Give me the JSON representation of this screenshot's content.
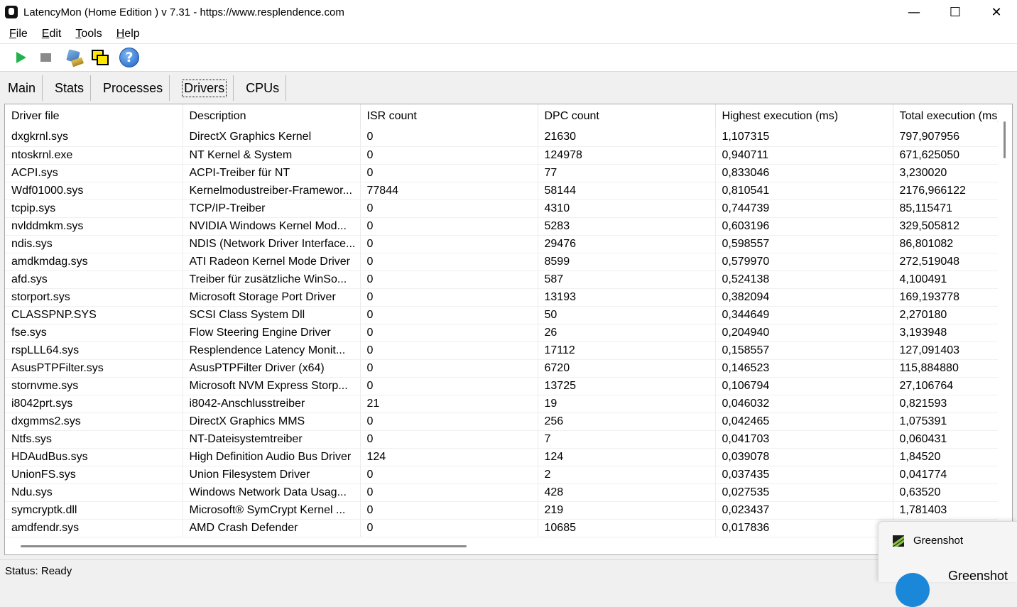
{
  "window": {
    "title": "LatencyMon  (Home Edition )  v 7.31 - https://www.resplendence.com",
    "minimize": "—",
    "maximize": "☐",
    "close": "✕"
  },
  "menu": [
    "File",
    "Edit",
    "Tools",
    "Help"
  ],
  "toolbar": {
    "icons": [
      "play-icon",
      "stop-icon",
      "broom-icon",
      "windows-icon",
      "help-icon"
    ],
    "help_glyph": "?"
  },
  "tabs": [
    "Main",
    "Stats",
    "Processes",
    "Drivers",
    "CPUs"
  ],
  "active_tab": "Drivers",
  "drivers": {
    "columns": [
      "Driver file",
      "Description",
      "ISR count",
      "DPC count",
      "Highest execution (ms)",
      "Total execution (ms)"
    ],
    "rows": [
      [
        "dxgkrnl.sys",
        "DirectX Graphics Kernel",
        "0",
        "21630",
        "1,107315",
        "797,907956"
      ],
      [
        "ntoskrnl.exe",
        "NT Kernel & System",
        "0",
        "124978",
        "0,940711",
        "671,625050"
      ],
      [
        "ACPI.sys",
        "ACPI-Treiber für NT",
        "0",
        "77",
        "0,833046",
        "3,230020"
      ],
      [
        "Wdf01000.sys",
        "Kernelmodustreiber-Framewor...",
        "77844",
        "58144",
        "0,810541",
        "2176,966122"
      ],
      [
        "tcpip.sys",
        "TCP/IP-Treiber",
        "0",
        "4310",
        "0,744739",
        "85,115471"
      ],
      [
        "nvlddmkm.sys",
        "NVIDIA Windows Kernel Mod...",
        "0",
        "5283",
        "0,603196",
        "329,505812"
      ],
      [
        "ndis.sys",
        "NDIS (Network Driver Interface...",
        "0",
        "29476",
        "0,598557",
        "86,801082"
      ],
      [
        "amdkmdag.sys",
        "ATI Radeon Kernel Mode Driver",
        "0",
        "8599",
        "0,579970",
        "272,519048"
      ],
      [
        "afd.sys",
        "Treiber für zusätzliche WinSo...",
        "0",
        "587",
        "0,524138",
        "4,100491"
      ],
      [
        "storport.sys",
        "Microsoft Storage Port Driver",
        "0",
        "13193",
        "0,382094",
        "169,193778"
      ],
      [
        "CLASSPNP.SYS",
        "SCSI Class System Dll",
        "0",
        "50",
        "0,344649",
        "2,270180"
      ],
      [
        "fse.sys",
        "Flow Steering Engine Driver",
        "0",
        "26",
        "0,204940",
        "3,193948"
      ],
      [
        "rspLLL64.sys",
        "Resplendence Latency Monit...",
        "0",
        "17112",
        "0,158557",
        "127,091403"
      ],
      [
        "AsusPTPFilter.sys",
        "AsusPTPFilter Driver (x64)",
        "0",
        "6720",
        "0,146523",
        "115,884880"
      ],
      [
        "stornvme.sys",
        "Microsoft NVM Express Storp...",
        "0",
        "13725",
        "0,106794",
        "27,106764"
      ],
      [
        "i8042prt.sys",
        "i8042-Anschlusstreiber",
        "21",
        "19",
        "0,046032",
        "0,821593"
      ],
      [
        "dxgmms2.sys",
        "DirectX Graphics MMS",
        "0",
        "256",
        "0,042465",
        "1,075391"
      ],
      [
        "Ntfs.sys",
        "NT-Dateisystemtreiber",
        "0",
        "7",
        "0,041703",
        "0,060431"
      ],
      [
        "HDAudBus.sys",
        "High Definition Audio Bus Driver",
        "124",
        "124",
        "0,039078",
        "1,84520"
      ],
      [
        "UnionFS.sys",
        "Union Filesystem Driver",
        "0",
        "2",
        "0,037435",
        "0,041774"
      ],
      [
        "Ndu.sys",
        "Windows Network Data Usag...",
        "0",
        "428",
        "0,027535",
        "0,63520"
      ],
      [
        "symcryptk.dll",
        "Microsoft® SymCrypt Kernel ...",
        "0",
        "219",
        "0,023437",
        "1,781403"
      ],
      [
        "amdfendr.sys",
        "AMD Crash Defender",
        "0",
        "10685",
        "0,017836",
        ""
      ]
    ]
  },
  "status": "Status: Ready",
  "notification": {
    "app": "Greenshot",
    "title": "Greenshot"
  }
}
